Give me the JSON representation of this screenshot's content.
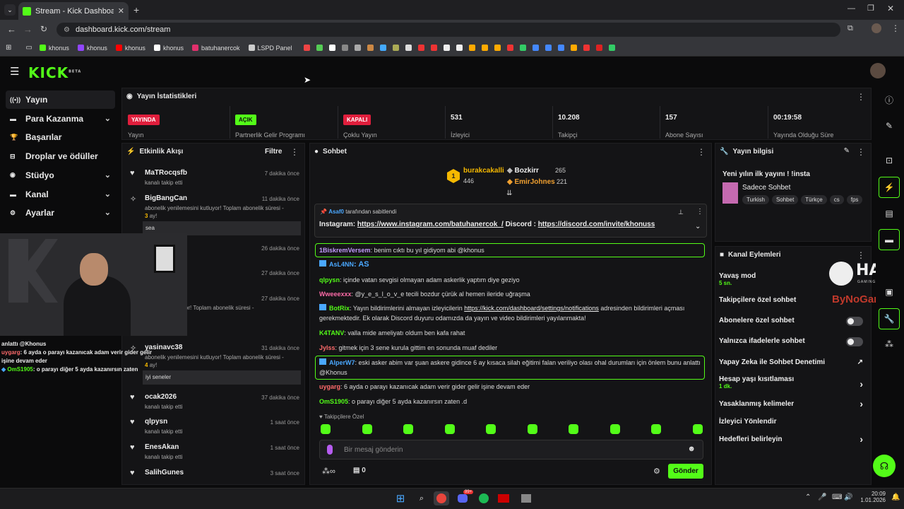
{
  "browser": {
    "tab_title": "Stream - Kick Dashboard",
    "url": "dashboard.kick.com/stream"
  },
  "bookmarks": [
    {
      "label": "khonus",
      "color": "#53fc18"
    },
    {
      "label": "khonus",
      "color": "#9146ff"
    },
    {
      "label": "khonus",
      "color": "#ff0000"
    },
    {
      "label": "khonus",
      "color": "#ffffff"
    },
    {
      "label": "batuhanercok",
      "color": "#e1306c"
    },
    {
      "label": "LSPD Panel",
      "color": "#cccccc"
    }
  ],
  "app": {
    "logo": "KICK",
    "logo_sup": "BETA"
  },
  "sidebar": {
    "items": [
      {
        "label": "Yayın",
        "icon": "broadcast-icon",
        "active": true,
        "chevron": false
      },
      {
        "label": "Para Kazanma",
        "icon": "money-icon",
        "chevron": true
      },
      {
        "label": "Başarılar",
        "icon": "trophy-icon",
        "chevron": false
      },
      {
        "label": "Droplar ve ödüller",
        "icon": "gift-icon",
        "chevron": false
      },
      {
        "label": "Stüdyo",
        "icon": "studio-icon",
        "chevron": true
      },
      {
        "label": "Kanal",
        "icon": "channel-icon",
        "chevron": true
      },
      {
        "label": "Ayarlar",
        "icon": "gear-icon",
        "chevron": true
      }
    ]
  },
  "stats": {
    "title": "Yayın İstatistikleri",
    "items": [
      {
        "badge": "YAYINDA",
        "badge_color": "#e01e3c",
        "label": "Yayın"
      },
      {
        "badge": "AÇIK",
        "badge_color": "#53fc18",
        "label": "Partnerlik Gelir Programı"
      },
      {
        "badge": "KAPALI",
        "badge_color": "#e01e3c",
        "label": "Çoklu Yayın"
      },
      {
        "value": "531",
        "label": "İzleyici"
      },
      {
        "value": "10.208",
        "label": "Takipçi"
      },
      {
        "value": "157",
        "label": "Abone Sayısı"
      },
      {
        "value": "00:19:58",
        "label": "Yayında Olduğu Süre"
      }
    ]
  },
  "activity": {
    "title": "Etkinlik Akışı",
    "filter": "Filtre",
    "items": [
      {
        "name": "MaTRocqsfb",
        "time": "7 dakika önce",
        "sub": "kanalı takip etti"
      },
      {
        "name": "BigBangCan",
        "time": "11 dakika önce",
        "sub": "abonelik yenilemesini kutluyor! Toplam abonelik süresi -",
        "months": "3",
        "months_suffix": "ay!",
        "quote": "sea"
      },
      {
        "time": "26 dakika önce"
      },
      {
        "time": "27 dakika önce"
      },
      {
        "time": "27 dakika önce",
        "sub": "elemesini kutluyor! Toplam abonelik süresi -"
      },
      {
        "name": "yasinavc38",
        "time": "31 dakika önce",
        "sub": "abonelik yenilemesini kutluyor! Toplam abonelik süresi -",
        "months": "4",
        "months_suffix": "ay!",
        "quote": "iyi seneler"
      },
      {
        "name": "ocak2026",
        "time": "37 dakika önce",
        "sub": "kanalı takip etti"
      },
      {
        "name": "qlpysn",
        "time": "1 saat önce",
        "sub": "kanalı takip etti"
      },
      {
        "name": "EnesAkan",
        "time": "1 saat önce",
        "sub": "kanalı takip etti"
      },
      {
        "name": "SalihGunes",
        "time": "3 saat önce"
      }
    ]
  },
  "overlay": {
    "lines": [
      {
        "text": "anlattı @Khonus"
      },
      {
        "user": "uygarg",
        "text": ": 6 ayda o parayı kazanıcak adam verir gider gelir işine devam eder"
      },
      {
        "user": "OmS1905",
        "text": ": o parayı diğer 5 ayda kazanırsın zaten"
      }
    ]
  },
  "chat": {
    "title": "Sohbet",
    "top": [
      {
        "name": "burakcakalli",
        "amount": "446",
        "rank": "1"
      },
      {
        "name": "Bozkirr",
        "amount": "265"
      },
      {
        "name": "EmirJohnes",
        "amount": "221"
      }
    ],
    "pinned": {
      "by": "Asaf0",
      "by_suffix": "tarafından sabitlendi",
      "text_a": "Instagram: ",
      "link_a": "https://www.instagram.com/batuhanercok_/",
      "text_b": " Discord : ",
      "link_b": "https://discord.com/invite/khonuss"
    },
    "messages": [
      {
        "user": "1BiskremVersem",
        "color": "#c39bff",
        "text": ": benim cıktı bu yıl gidiyom abi @khonus",
        "hl": true
      },
      {
        "user": "AsL4NN",
        "color": "#4aa8ff",
        "text": ": AS",
        "big": true
      },
      {
        "user": "qlpysn",
        "color": "#53fc18",
        "text": ": içinde vatan sevgisi olmayan adam askerlik yaptım diye geziyo"
      },
      {
        "user": "Wweeexxx",
        "color": "#ff6ba8",
        "text": ": @y_e_s_l_o_v_e tecili bozdur çürük al hemen ileride uğraşma"
      },
      {
        "user": "BotRix",
        "color": "#53fc18",
        "text": ": Yayın bildirimlerini almayan izleyicilerin ",
        "link": "https://kick.com/dashboard/settings/notifications",
        "text2": " adresinden bildirimleri açması gerekmektedir. Ek olarak Discord duyuru odamızda da yayın ve video bildirimleri yayılanmakta!"
      },
      {
        "user": "K4TANV",
        "color": "#53fc18",
        "text": ": valla mide ameliyatı oldum ben kafa rahat"
      },
      {
        "user": "Jylss",
        "color": "#ff6b6b",
        "text": ": gitmek için 3 sene kurula gittim en sonunda muaf dediler"
      },
      {
        "user": "AlperW7",
        "color": "#4aa8ff",
        "text": ": eski asker abim var şuan askere gidince 6 ay kısaca silah eğitimi falan veriliyo olası ohal durumları için önlem bunu anlattı @Khonus",
        "hl": true
      },
      {
        "user": "uygarg",
        "color": "#ff6b6b",
        "text": ": 6 ayda o parayı kazanıcak adam verir gider gelir işine devam eder"
      },
      {
        "user": "OmS1905",
        "color": "#53fc18",
        "text": ": o parayı diğer 5 ayda kazanırsın zaten .d"
      }
    ],
    "followers_only": "Takipçilere Özel",
    "placeholder": "Bir mesaj gönderin",
    "send": "Gönder",
    "points": "0"
  },
  "info": {
    "title": "Yayın bilgisi",
    "stream_title": "Yeni yılın ilk yayını ! !insta",
    "category": "Sadece Sohbet",
    "tags": [
      "Turkish",
      "Sohbet",
      "Türkçe",
      "cs",
      "fps"
    ]
  },
  "actions": {
    "title": "Kanal Eylemleri",
    "slow_mode": "Yavaş mod",
    "slow_value": "5 sn.",
    "followers_chat": "Takipçilere özel sohbet",
    "subs_chat": "Abonelere özel sohbet",
    "emote_chat": "Yalnızca ifadelerle sohbet",
    "ai_mod": "Yapay Zeka ile Sohbet Denetimi",
    "age": "Hesap yaşı kısıtlaması",
    "age_value": "1 dk.",
    "banned_words": "Yasaklanmış kelimeler",
    "raid": "İzleyici Yönlendir",
    "goals": "Hedefleri belirleyin"
  },
  "sponsor": {
    "hawk": "HAWK",
    "hawk_sub": "GAMING CHAIR",
    "bynogame": "ByNoGame"
  },
  "taskbar": {
    "time": "20:09",
    "date": "1.01.2026",
    "badge": "99+"
  },
  "colors": {
    "accent": "#53fc18",
    "live": "#e01e3c"
  }
}
